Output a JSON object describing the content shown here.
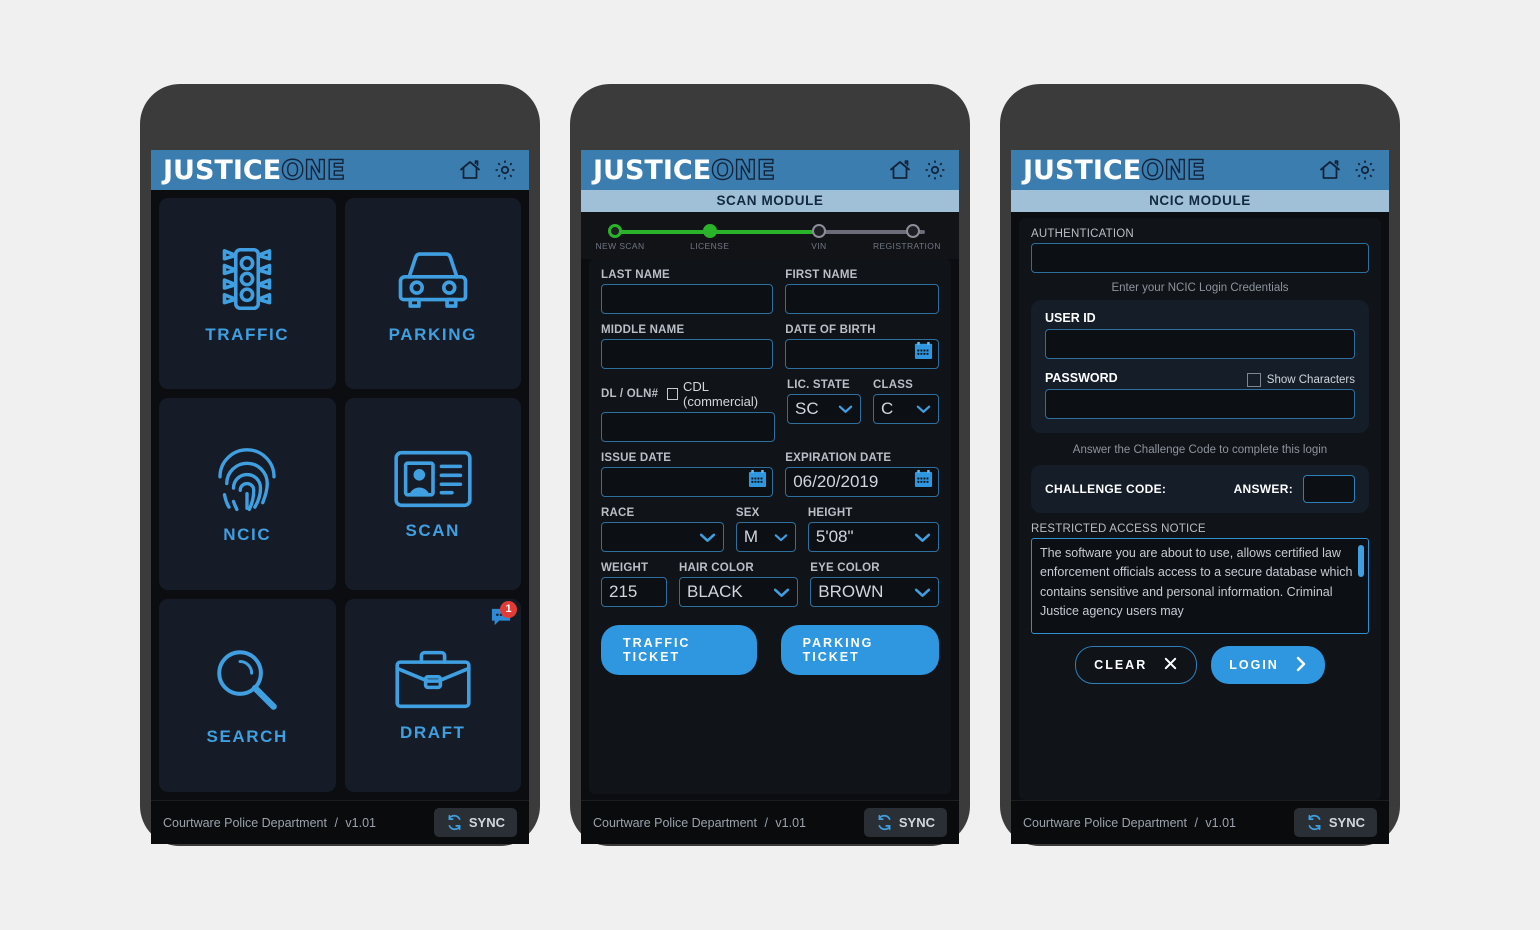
{
  "app": {
    "logo_word1": "JUSTICE",
    "logo_word2": "ONE",
    "home_icon": "home-icon",
    "gear_icon": "gear-icon"
  },
  "footer": {
    "department": "Courtware Police Department",
    "separator": "/",
    "version": "v1.01",
    "sync_label": "SYNC",
    "sync_icon": "sync-refresh-icon"
  },
  "phone1": {
    "tiles": [
      {
        "label": "TRAFFIC",
        "icon": "traffic-light-icon"
      },
      {
        "label": "PARKING",
        "icon": "car-icon"
      },
      {
        "label": "NCIC",
        "icon": "fingerprint-icon"
      },
      {
        "label": "SCAN",
        "icon": "id-card-icon"
      },
      {
        "label": "SEARCH",
        "icon": "magnifier-icon"
      },
      {
        "label": "DRAFT",
        "icon": "briefcase-icon",
        "badge_icon": "chat-bubble-icon",
        "badge_count": "1"
      }
    ]
  },
  "phone2": {
    "module_title": "SCAN MODULE",
    "stepper": {
      "steps": [
        {
          "label": "NEW SCAN",
          "state": "active-ring"
        },
        {
          "label": "LICENSE",
          "state": "complete"
        },
        {
          "label": "VIN",
          "state": "pending"
        },
        {
          "label": "REGISTRATION",
          "state": "pending"
        }
      ]
    },
    "fields": {
      "last_name": {
        "label": "LAST NAME",
        "value": ""
      },
      "first_name": {
        "label": "FIRST NAME",
        "value": ""
      },
      "middle_name": {
        "label": "MIDDLE NAME",
        "value": ""
      },
      "date_of_birth": {
        "label": "DATE OF BIRTH",
        "value": "",
        "icon": "calendar-icon"
      },
      "dl_oln": {
        "label": "DL / OLN#",
        "value": ""
      },
      "cdl": {
        "label": "CDL (commercial)",
        "checked": false
      },
      "lic_state": {
        "label": "LIC. STATE",
        "value": "SC"
      },
      "class": {
        "label": "CLASS",
        "value": "C"
      },
      "issue_date": {
        "label": "ISSUE DATE",
        "value": "",
        "icon": "calendar-icon"
      },
      "expiration_date": {
        "label": "EXPIRATION DATE",
        "value": "06/20/2019",
        "icon": "calendar-icon"
      },
      "race": {
        "label": "RACE",
        "value": ""
      },
      "sex": {
        "label": "SEX",
        "value": "M"
      },
      "height": {
        "label": "HEIGHT",
        "value": "5'08\""
      },
      "weight": {
        "label": "WEIGHT",
        "value": "215"
      },
      "hair_color": {
        "label": "HAIR COLOR",
        "value": "BLACK"
      },
      "eye_color": {
        "label": "EYE COLOR",
        "value": "BROWN"
      }
    },
    "buttons": {
      "traffic_ticket": "TRAFFIC TICKET",
      "parking_ticket": "PARKING TICKET"
    }
  },
  "phone3": {
    "module_title": "NCIC MODULE",
    "authentication": {
      "label": "AUTHENTICATION",
      "value": ""
    },
    "credentials_hint": "Enter your NCIC Login Credentials",
    "user_id": {
      "label": "USER ID",
      "value": ""
    },
    "password": {
      "label": "PASSWORD",
      "value": ""
    },
    "show_characters": {
      "label": "Show Characters",
      "checked": false
    },
    "challenge_hint": "Answer the Challenge Code to complete this login",
    "challenge_code_label": "CHALLENGE CODE:",
    "challenge_code_value": "",
    "answer_label": "ANSWER:",
    "answer_value": "",
    "notice_label": "RESTRICTED ACCESS NOTICE",
    "notice_text": "The software you are about to use, allows certified law enforcement officials access to a secure database which contains sensitive and personal information.  Criminal Justice agency users may",
    "buttons": {
      "clear": "CLEAR",
      "clear_icon": "close-x-icon",
      "login": "LOGIN",
      "login_icon": "chevron-right-icon"
    }
  },
  "colors": {
    "header_blue": "#3c7db0",
    "subbar_blue": "#9fc0d7",
    "accent_blue": "#2f97e0",
    "tile_blue": "#3f9fe0",
    "page_bg": "#f0f0f0",
    "phone_frame": "#3b3b3b",
    "screen_bg": "#0b0d10",
    "step_green": "#2ab32a",
    "badge_red": "#e23b36"
  }
}
